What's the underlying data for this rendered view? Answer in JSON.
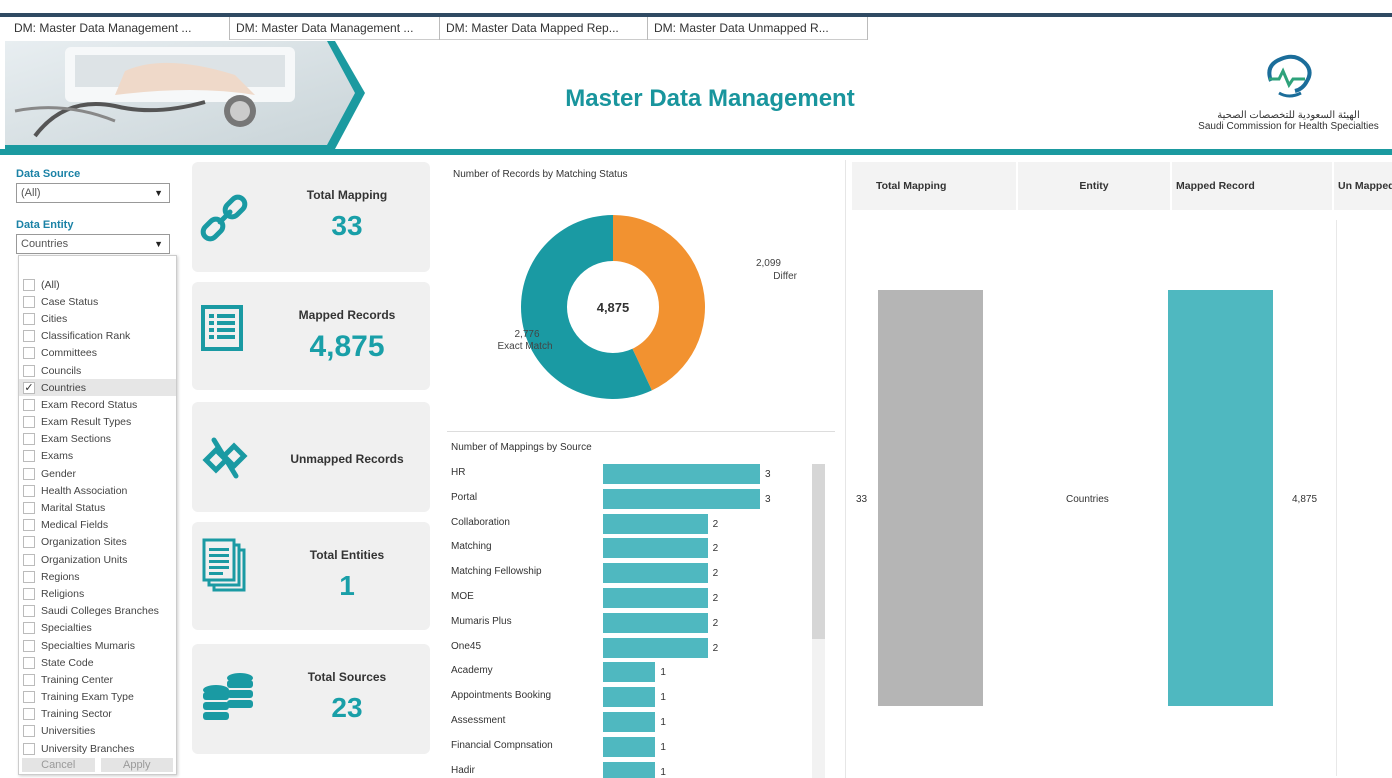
{
  "tabs": [
    "DM: Master Data Management ...",
    "DM: Master Data Management ...",
    "DM: Master Data Mapped Rep...",
    "DM: Master Data Unmapped R..."
  ],
  "header": {
    "title": "Master Data Management",
    "logo_arabic": "الهيئة السعودية للتخصصات الصحية",
    "logo_english": "Saudi Commission for Health Specialties"
  },
  "filters": {
    "data_source_label": "Data Source",
    "data_source_value": "(All)",
    "data_entity_label": "Data Entity",
    "data_entity_value": "Countries",
    "options": [
      "(All)",
      "Case Status",
      "Cities",
      "Classification Rank",
      "Committees",
      "Councils",
      "Countries",
      "Exam Record Status",
      "Exam Result Types",
      "Exam Sections",
      "Exams",
      "Gender",
      "Health Association",
      "Marital Status",
      "Medical Fields",
      "Organization Sites",
      "Organization Units",
      "Regions",
      "Religions",
      "Saudi Colleges Branches",
      "Specialties",
      "Specialties Mumaris",
      "State Code",
      "Training Center",
      "Training Exam Type",
      "Training Sector",
      "Universities",
      "University Branches"
    ],
    "checked_index": 6,
    "cancel_label": "Cancel",
    "apply_label": "Apply"
  },
  "kpis": {
    "total_mapping_label": "Total Mapping",
    "total_mapping_value": "33",
    "mapped_records_label": "Mapped Records",
    "mapped_records_value": "4,875",
    "unmapped_records_label": "Unmapped Records",
    "total_entities_label": "Total Entities",
    "total_entities_value": "1",
    "total_sources_label": "Total Sources",
    "total_sources_value": "23"
  },
  "donut": {
    "title": "Number of Records by Matching Status",
    "center_value": "4,875",
    "differ_value": "2,099",
    "differ_label": "Differ",
    "exact_value": "2,776",
    "exact_label": "Exact Match"
  },
  "bars_title": "Number of Mappings by Source",
  "table": {
    "headers": [
      "Total Mapping",
      "Entity",
      "Mapped Record",
      "Un Mapped"
    ],
    "total_mapping": "33",
    "entity": "Countries",
    "mapped_record": "4,875"
  },
  "colors": {
    "teal": "#1a9aa3",
    "orange": "#f29230",
    "bar": "#4fb8c0",
    "gray_bar": "#b5b5b5"
  },
  "chart_data": [
    {
      "type": "pie",
      "title": "Number of Records by Matching Status",
      "categories": [
        "Differ",
        "Exact Match"
      ],
      "values": [
        2099,
        2776
      ],
      "total": 4875
    },
    {
      "type": "bar",
      "title": "Number of Mappings by Source",
      "categories": [
        "HR",
        "Portal",
        "Collaboration",
        "Matching",
        "Matching Fellowship",
        "MOE",
        "Mumaris Plus",
        "One45",
        "Academy",
        "Appointments Booking",
        "Assessment",
        "Financial Compnsation",
        "Hadir"
      ],
      "values": [
        3,
        3,
        2,
        2,
        2,
        2,
        2,
        2,
        1,
        1,
        1,
        1,
        1
      ]
    },
    {
      "type": "bar",
      "title": "",
      "categories": [
        "Total Mapping",
        "Mapped Record"
      ],
      "values": [
        33,
        4875
      ]
    }
  ]
}
